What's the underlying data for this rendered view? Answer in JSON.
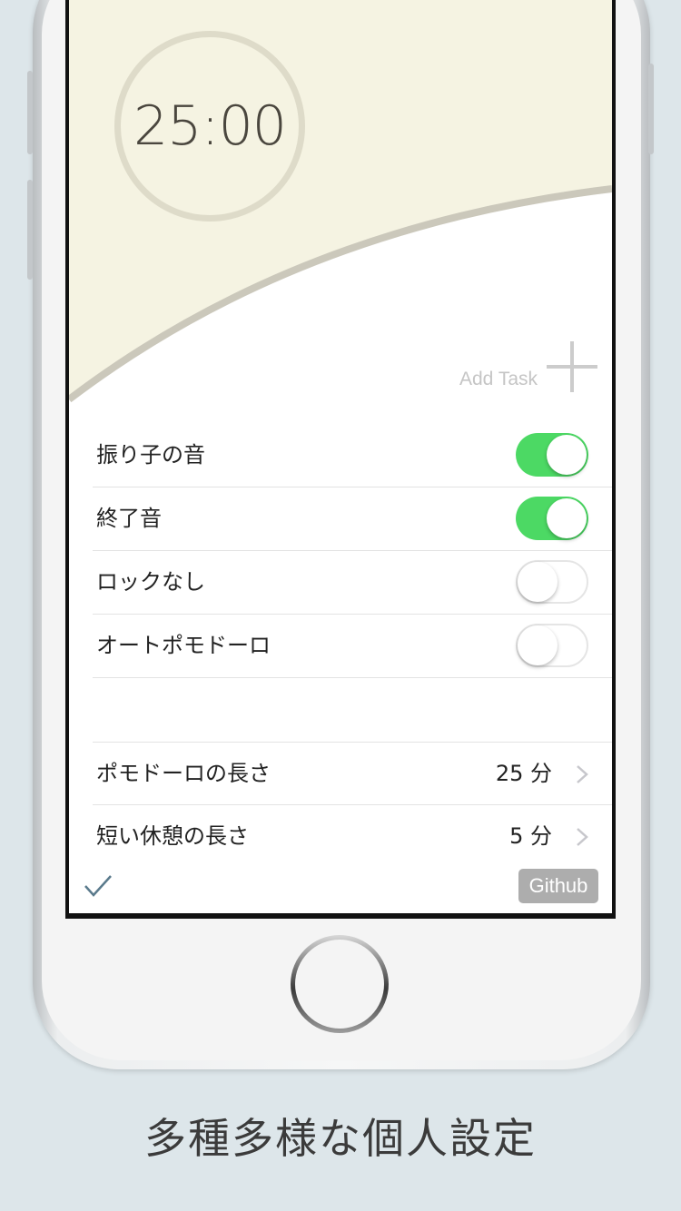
{
  "timer": {
    "display": "25:00"
  },
  "add_task": {
    "label": "Add Task",
    "icon": "plus-icon"
  },
  "toggles": [
    {
      "label": "振り子の音",
      "on": true
    },
    {
      "label": "終了音",
      "on": true
    },
    {
      "label": "ロックなし",
      "on": false
    },
    {
      "label": "オートポモドーロ",
      "on": false
    }
  ],
  "settings": [
    {
      "label": "ポモドーロの長さ",
      "value": "25 分"
    },
    {
      "label": "短い休憩の長さ",
      "value": "5 分"
    }
  ],
  "footer": {
    "check_icon": "check-icon",
    "github_label": "Github"
  },
  "caption": "多種多様な個人設定",
  "colors": {
    "header_bg": "#f5f3e2",
    "curve_stroke": "#cbc8bb",
    "timer_ring": "#dedbc9",
    "toggle_on": "#4cd964",
    "github_bg": "#adadad",
    "page_bg": "#dde6ea"
  }
}
